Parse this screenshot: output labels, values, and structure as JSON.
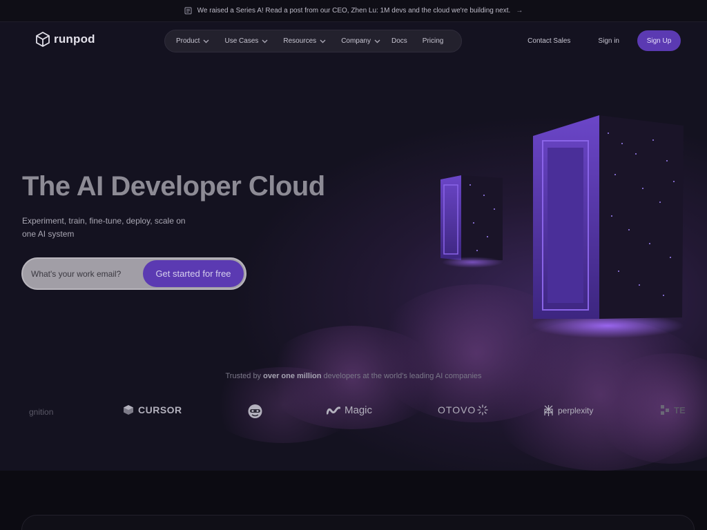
{
  "announcement": {
    "text": "We raised a Series A! Read a post from our CEO, Zhen Lu: 1M devs and the cloud we're building next.",
    "arrow": "→"
  },
  "nav": {
    "logo_text": "runpod",
    "items": [
      {
        "label": "Product",
        "has_dropdown": true
      },
      {
        "label": "Use Cases",
        "has_dropdown": true
      },
      {
        "label": "Resources",
        "has_dropdown": true
      },
      {
        "label": "Company",
        "has_dropdown": true
      },
      {
        "label": "Docs",
        "has_dropdown": false
      },
      {
        "label": "Pricing",
        "has_dropdown": false
      }
    ],
    "contact_sales": "Contact Sales",
    "sign_in": "Sign in",
    "sign_up": "Sign Up"
  },
  "hero": {
    "headline": "The AI Developer Cloud",
    "subline": "Experiment, train, fine-tune, deploy, scale on one AI system",
    "email_placeholder": "What's your work email?",
    "cta": "Get started for free"
  },
  "trusted": {
    "prefix": "Trusted by ",
    "highlight": "over one million",
    "suffix": " developers at the world's leading AI companies"
  },
  "logos": [
    {
      "name": "gnition",
      "icon": "none"
    },
    {
      "name": "CURSOR",
      "icon": "cursor-cube-icon"
    },
    {
      "name": "",
      "icon": "mascot-icon"
    },
    {
      "name": "Magic",
      "icon": "magic-wave-icon"
    },
    {
      "name": "OTOVO",
      "icon": "sunburst-icon"
    },
    {
      "name": "perplexity",
      "icon": "perplexity-icon"
    },
    {
      "name": "TE",
      "icon": "blocks-icon"
    }
  ],
  "colors": {
    "accent": "#5b3ab2",
    "background": "#0c0b12",
    "nav_pill": "#23212d"
  }
}
